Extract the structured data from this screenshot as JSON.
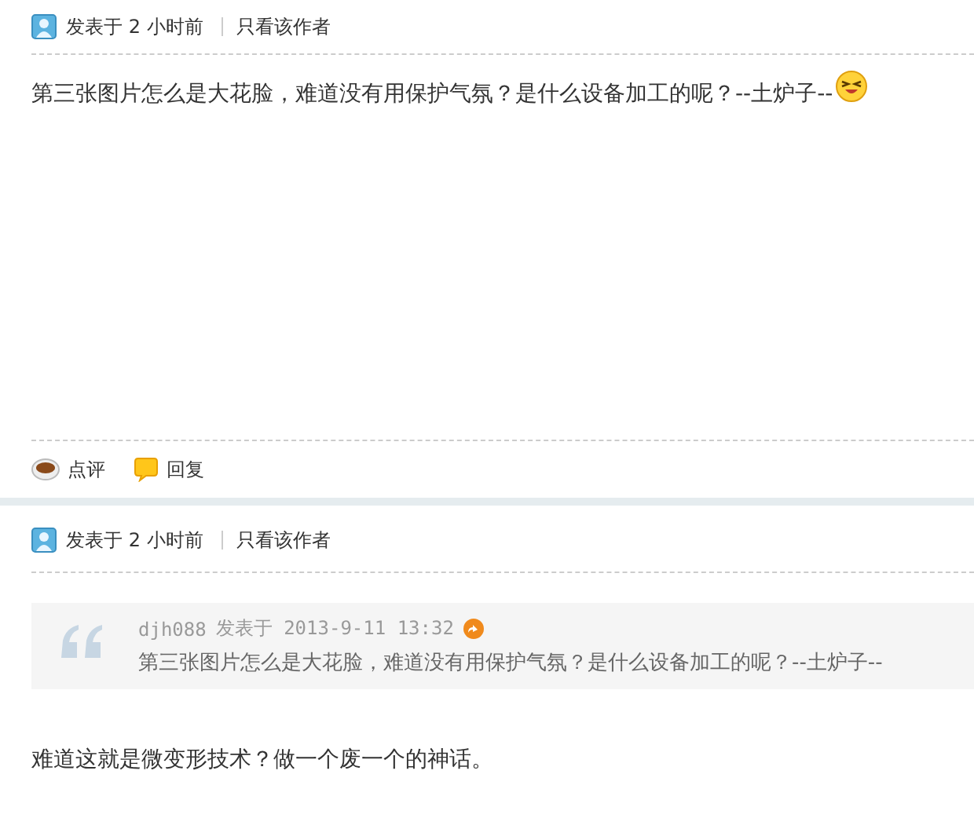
{
  "posts": [
    {
      "meta": {
        "posted": "发表于 2 小时前",
        "author_filter": "只看该作者"
      },
      "body": "第三张图片怎么是大花脸，难道没有用保护气氛？是什么设备加工的呢？--土炉子--",
      "emoji": true,
      "actions": [
        {
          "kind": "comment",
          "label": "点评"
        },
        {
          "kind": "reply",
          "label": "回复"
        }
      ]
    },
    {
      "meta": {
        "posted": "发表于 2 小时前",
        "author_filter": "只看该作者"
      },
      "quote": {
        "author": "djh088",
        "posted": "发表于 2013-9-11 13:32",
        "text": "第三张图片怎么是大花脸，难道没有用保护气氛？是什么设备加工的呢？--土炉子--"
      },
      "body": "难道这就是微变形技术？做一个废一个的神话。",
      "emoji": false
    }
  ]
}
